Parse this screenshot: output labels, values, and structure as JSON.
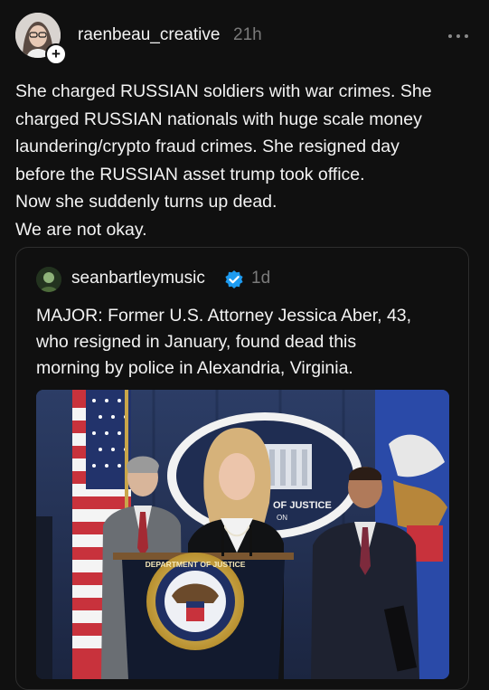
{
  "post": {
    "username": "raenbeau_creative",
    "time": "21h",
    "follow_symbol": "+",
    "more_icon": "ellipsis-icon",
    "text_lines": [
      "She charged RUSSIAN soldiers with war crimes. She",
      "charged RUSSIAN nationals with huge scale money",
      "laundering/crypto fraud crimes. She resigned day",
      "before the RUSSIAN asset trump took office.",
      "Now she suddenly turns up dead.",
      "We are not okay."
    ]
  },
  "quoted_post": {
    "username": "seanbartleymusic",
    "verified_icon": "verified-badge-icon",
    "time": "1d",
    "text_lines": [
      "MAJOR: Former U.S. Attorney Jessica Aber, 43,",
      "who resigned in January, found dead this",
      "morning by police in Alexandria, Virginia."
    ],
    "image": {
      "seal_text": "DEPARTMENT OF JUSTICE",
      "backdrop_text": "OF JUSTICE",
      "backdrop_text_2": "ON"
    }
  },
  "colors": {
    "background": "#101010",
    "text": "#f3f3f3",
    "muted": "#7a7a7a",
    "verified": "#1d9bf0"
  }
}
